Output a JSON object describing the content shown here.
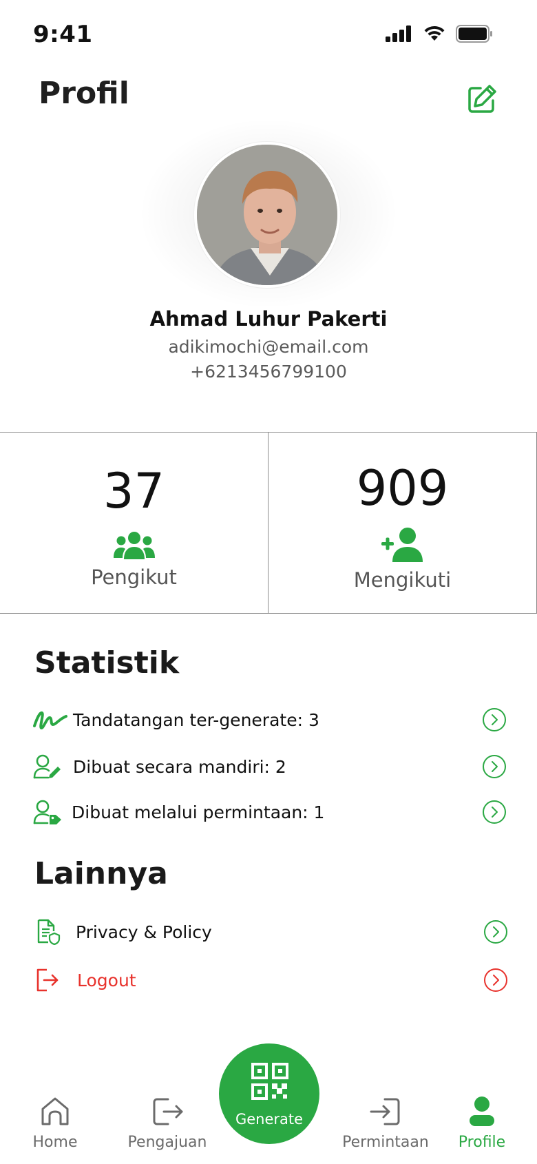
{
  "status_bar": {
    "time": "9:41",
    "icons": [
      "signal-icon",
      "wifi-icon",
      "battery-icon"
    ]
  },
  "header": {
    "title": "Profil",
    "edit_icon": "edit-icon"
  },
  "profile": {
    "name": "Ahmad Luhur Pakerti",
    "email": "adikimochi@email.com",
    "phone": "+6213456799100"
  },
  "stats": {
    "followers": {
      "count": "37",
      "label": "Pengikut",
      "icon": "users-icon"
    },
    "following": {
      "count": "909",
      "label": "Mengikuti",
      "icon": "user-plus-icon"
    }
  },
  "statistik": {
    "title": "Statistik",
    "items": [
      {
        "label": "Tandatangan ter-generate: 3",
        "icon": "signature-icon"
      },
      {
        "label": "Dibuat secara mandiri: 2",
        "icon": "user-edit-icon"
      },
      {
        "label": "Dibuat melalui permintaan: 1",
        "icon": "user-tag-icon"
      }
    ]
  },
  "lainnya": {
    "title": "Lainnya",
    "items": [
      {
        "label": "Privacy & Policy",
        "icon": "document-shield-icon"
      },
      {
        "label": "Logout",
        "icon": "logout-icon"
      }
    ]
  },
  "nav": {
    "items": [
      {
        "label": "Home",
        "icon": "home-icon"
      },
      {
        "label": "Pengajuan",
        "icon": "submit-icon"
      },
      {
        "label": "Generate",
        "icon": "qr-code-icon"
      },
      {
        "label": "Permintaan",
        "icon": "request-icon"
      },
      {
        "label": "Profile",
        "icon": "profile-icon"
      }
    ],
    "active": "Profile"
  },
  "colors": {
    "accent": "#2aa843",
    "danger": "#e8322c",
    "text": "#111111",
    "muted": "#5a5a5a"
  }
}
